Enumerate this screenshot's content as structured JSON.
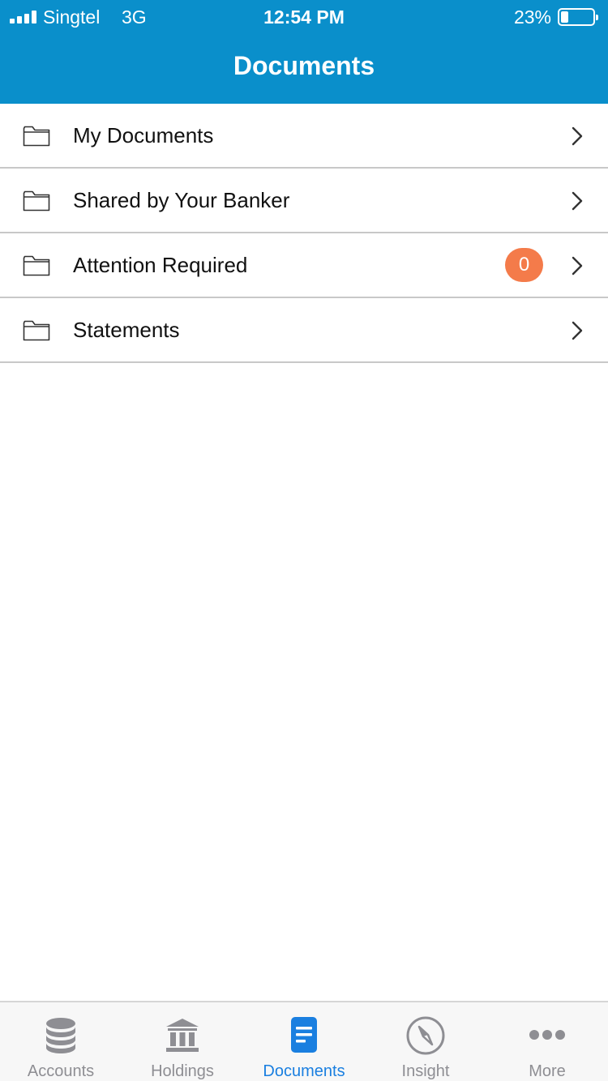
{
  "status_bar": {
    "carrier": "Singtel",
    "network": "3G",
    "time": "12:54 PM",
    "battery_percent": "23%",
    "battery_level": 0.23
  },
  "nav": {
    "title": "Documents"
  },
  "documents": [
    {
      "label": "My Documents",
      "icon": "folder-icon"
    },
    {
      "label": "Shared by Your Banker",
      "icon": "folder-icon"
    },
    {
      "label": "Attention Required",
      "icon": "folder-icon",
      "badge": "0"
    },
    {
      "label": "Statements",
      "icon": "folder-icon"
    }
  ],
  "tabs": [
    {
      "label": "Accounts",
      "icon": "database-icon",
      "active": false
    },
    {
      "label": "Holdings",
      "icon": "bank-icon",
      "active": false
    },
    {
      "label": "Documents",
      "icon": "document-icon",
      "active": true
    },
    {
      "label": "Insight",
      "icon": "compass-icon",
      "active": false
    },
    {
      "label": "More",
      "icon": "more-dots-icon",
      "active": false
    }
  ],
  "colors": {
    "brand_blue": "#0a8fcb",
    "active_tab": "#1a7fe0",
    "inactive_tab": "#8e8e93",
    "badge": "#f47b4a"
  }
}
